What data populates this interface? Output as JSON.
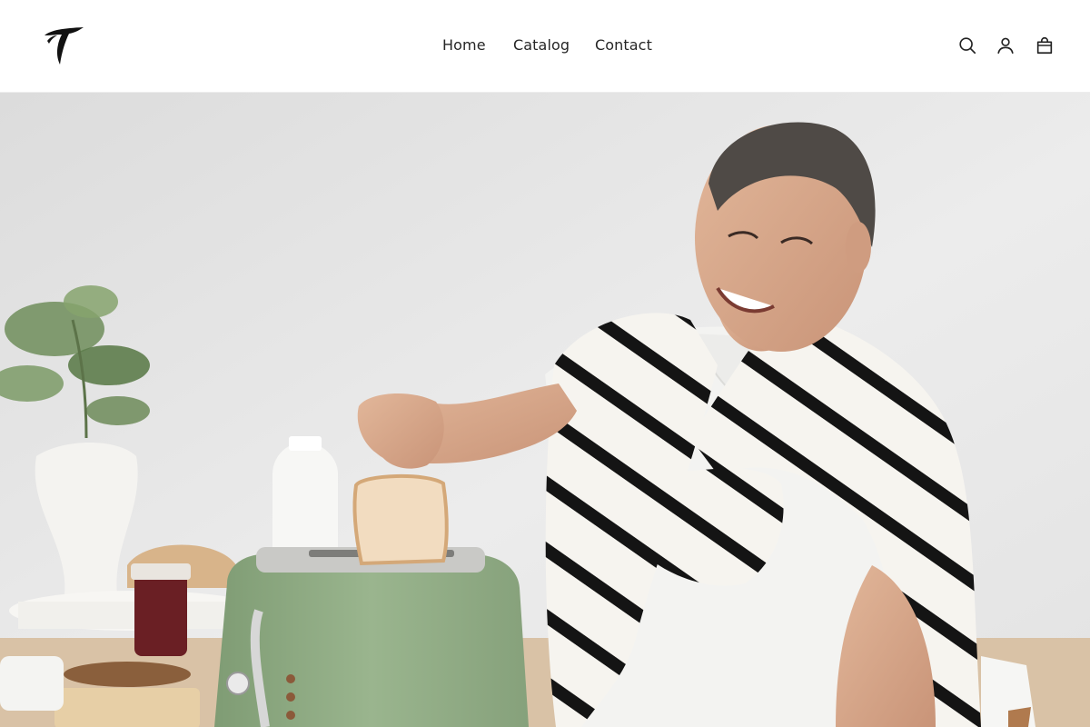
{
  "store": {
    "logo_icon": "stylized-T-logo"
  },
  "nav": {
    "items": [
      {
        "label": "Home"
      },
      {
        "label": "Catalog"
      },
      {
        "label": "Contact"
      }
    ]
  },
  "header_tools": {
    "search_icon": "search-icon",
    "account_icon": "account-icon",
    "cart_icon": "shopping-bag-icon"
  },
  "hero": {
    "image_subject": "smiling man in white polo with striped sweater putting bread into a green retro toaster at a kitchen table"
  },
  "colors": {
    "header_bg": "#ffffff",
    "text": "#262626",
    "hero_wall": "#e9e9e9",
    "toaster": "#8faa84",
    "sweater_stripe": "#111111"
  }
}
